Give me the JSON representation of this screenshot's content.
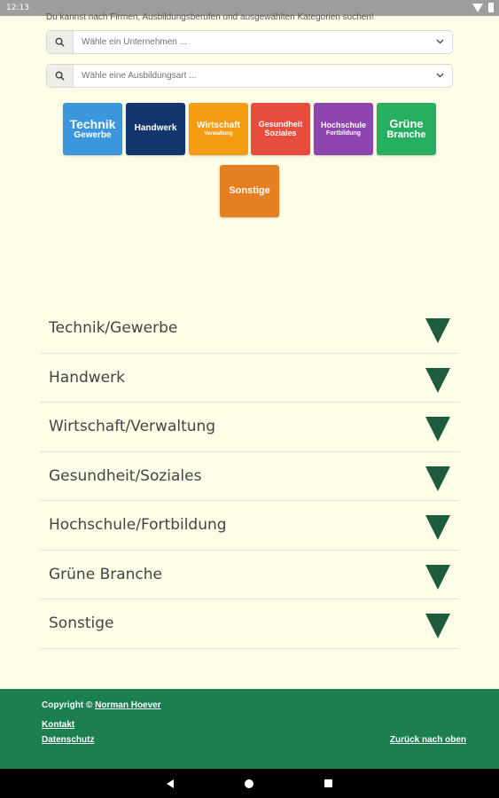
{
  "status": {
    "time": "12:13"
  },
  "intro": "Du kannst nach Firmen, Ausbildungsberufen und ausgewählten Kategorien suchen!",
  "search": {
    "company_placeholder": "Wähle ein Unternehmen ...",
    "type_placeholder": "Wähle eine Ausbildungsart ..."
  },
  "tiles": [
    {
      "line1": "Technik",
      "line2": "Gewerbe",
      "color": "#3a97dc"
    },
    {
      "line1": "Handwerk",
      "line2": "",
      "color": "#12366b"
    },
    {
      "line1": "Wirtschaft",
      "line2": "Verwaltung",
      "color": "#f39c12"
    },
    {
      "line1": "Gesundheit",
      "line2": "Soziales",
      "color": "#e74c3c"
    },
    {
      "line1": "Hochschule",
      "line2": "Fortbildung",
      "color": "#8e44ad"
    },
    {
      "line1": "Grüne",
      "line2": "Branche",
      "color": "#27ae60"
    },
    {
      "line1": "Sonstige",
      "line2": "",
      "color": "#e67e22"
    }
  ],
  "accordion": [
    "Technik/Gewerbe",
    "Handwerk",
    "Wirtschaft/Verwaltung",
    "Gesundheit/Soziales",
    "Hochschule/Fortbildung",
    "Grüne Branche",
    "Sonstige"
  ],
  "footer": {
    "copyright": "Copyright ©",
    "author": "Norman Hoever",
    "kontakt": "Kontakt",
    "datenschutz": "Datenschutz",
    "back_to_top": "Zurück nach oben",
    "color": "#1b7f4f"
  },
  "accent_color": "#1e5c3d"
}
